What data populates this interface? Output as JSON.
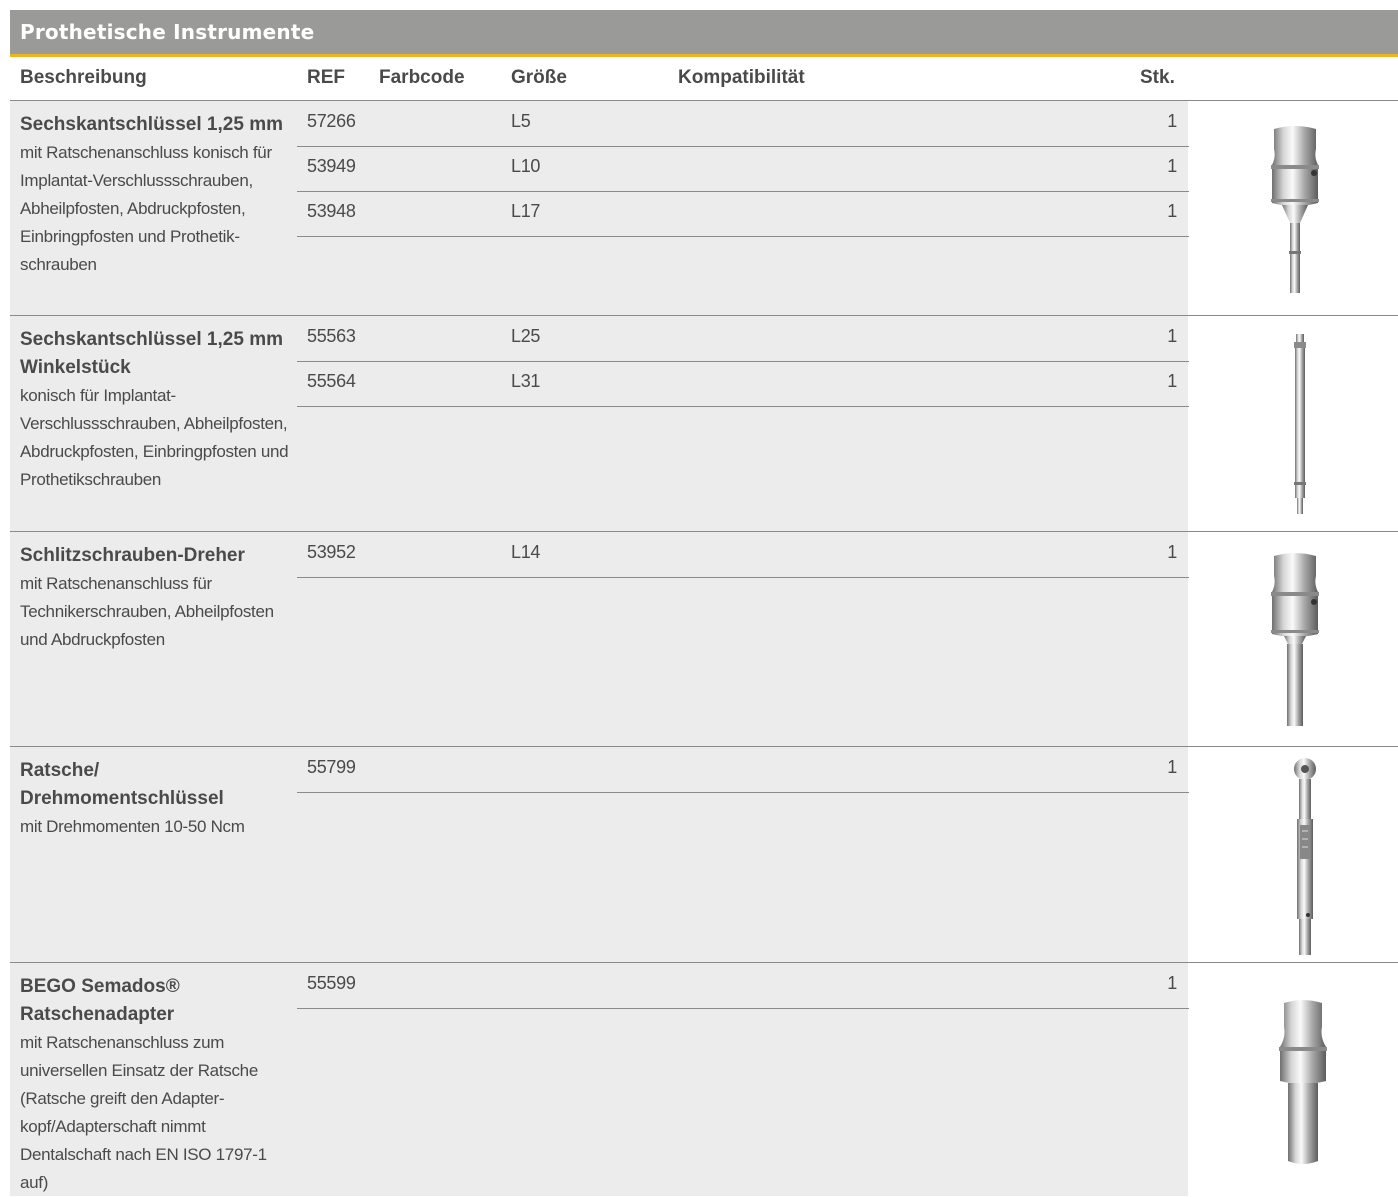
{
  "title": "Prothetische Instrumente",
  "columns": {
    "beschreibung": "Beschreibung",
    "ref": "REF",
    "farbcode": "Farbcode",
    "groesse": "Größe",
    "kompatibilitaet": "Kompatibilität",
    "stk": "Stk."
  },
  "products": [
    {
      "name": "Sechskantschlüssel 1,25 mm",
      "description": "mit Ratschenanschluss konisch für Implantat-Verschlussschrauben, Abheilpfosten, Abdruckpfosten, Einbringpfosten und Prothetik-schrauben",
      "rows": [
        {
          "ref": "57266",
          "size": "L5",
          "qty": "1"
        },
        {
          "ref": "53949",
          "size": "L10",
          "qty": "1"
        },
        {
          "ref": "53948",
          "size": "L17",
          "qty": "1"
        }
      ],
      "image_icon": "hex-driver-ratchet-image"
    },
    {
      "name": "Sechskantschlüssel 1,25 mm Winkelstück",
      "description": "konisch für Implantat-Verschlussschrauben, Abheilpfosten, Abdruckpfosten, Einbringpfosten und Prothetikschrauben",
      "rows": [
        {
          "ref": "55563",
          "size": "L25",
          "qty": "1"
        },
        {
          "ref": "55564",
          "size": "L31",
          "qty": "1"
        }
      ],
      "image_icon": "hex-driver-handpiece-image"
    },
    {
      "name": "Schlitzschrauben-Dreher",
      "description": "mit Ratschenanschluss für Technikerschrauben, Abheilpfosten und Abdruckpfosten",
      "rows": [
        {
          "ref": "53952",
          "size": "L14",
          "qty": "1"
        }
      ],
      "image_icon": "slot-screwdriver-image"
    },
    {
      "name": "Ratsche/ Drehmomentschlüssel",
      "description": "mit Drehmomenten 10-50 Ncm",
      "rows": [
        {
          "ref": "55799",
          "size": "",
          "qty": "1"
        }
      ],
      "image_icon": "torque-wrench-image"
    },
    {
      "name": "BEGO Semados® Ratschenadapter",
      "description": "mit Ratschenanschluss zum universellen Einsatz der Ratsche (Ratsche greift den Adapter-kopf/Adapterschaft nimmt Dentalschaft nach EN ISO 1797-1 auf)",
      "rows": [
        {
          "ref": "55599",
          "size": "",
          "qty": "1"
        }
      ],
      "image_icon": "ratchet-adapter-image"
    }
  ],
  "colors": {
    "title_bar": "#9a9a98",
    "accent": "#f0b323",
    "row_bg": "#ececec"
  }
}
